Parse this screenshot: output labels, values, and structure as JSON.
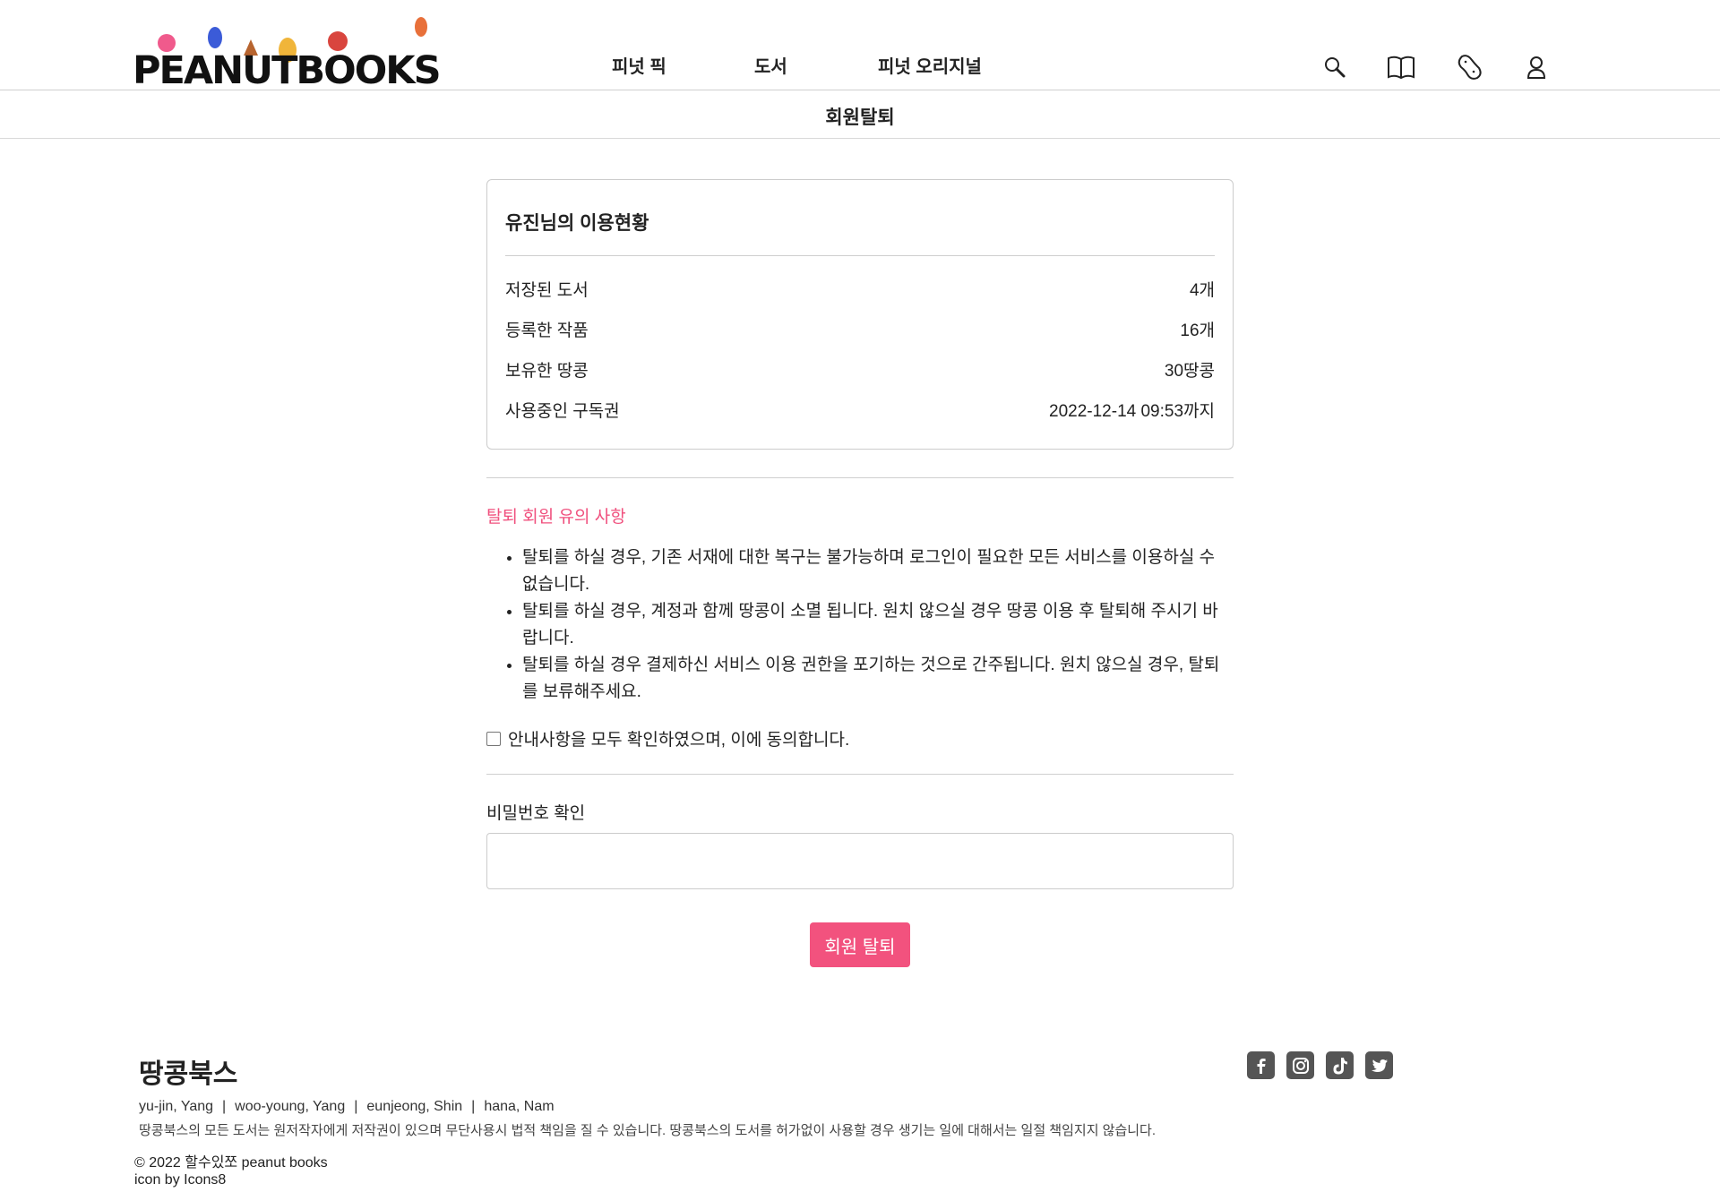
{
  "header": {
    "logo_text": "PEANUTBOOKS",
    "nav": [
      "피넛 픽",
      "도서",
      "피넛 오리지널"
    ],
    "icons": [
      "search-icon",
      "book-icon",
      "peanut-icon",
      "user-icon"
    ]
  },
  "page": {
    "title": "회원탈퇴"
  },
  "usage": {
    "title": "유진님의 이용현황",
    "rows": [
      {
        "label": "저장된 도서",
        "value": "4개"
      },
      {
        "label": "등록한 작품",
        "value": "16개"
      },
      {
        "label": "보유한 땅콩",
        "value": "30땅콩"
      },
      {
        "label": "사용중인 구독권",
        "value": "2022-12-14 09:53까지"
      }
    ]
  },
  "notice": {
    "title": "탈퇴 회원 유의 사항",
    "items": [
      "탈퇴를 하실 경우, 기존 서재에 대한 복구는 불가능하며 로그인이 필요한 모든 서비스를 이용하실 수 없습니다.",
      "탈퇴를 하실 경우, 계정과 함께 땅콩이 소멸 됩니다. 원치 않으실 경우 땅콩 이용 후 탈퇴해 주시기 바랍니다.",
      "탈퇴를 하실 경우 결제하신 서비스 이용 권한을 포기하는 것으로 간주됩니다. 원치 않으실 경우, 탈퇴를 보류해주세요."
    ],
    "agree_label": "안내사항을 모두 확인하였으며, 이에 동의합니다."
  },
  "password": {
    "label": "비밀번호 확인",
    "value": ""
  },
  "submit_label": "회원 탈퇴",
  "footer": {
    "brand": "땅콩북스",
    "team": [
      "yu-jin, Yang",
      "woo-young, Yang",
      "eunjeong, Shin",
      "hana, Nam"
    ],
    "notice": "땅콩북스의 모든 도서는 원저작자에게 저작권이 있으며 무단사용시 법적 책임을 질 수 있습니다. 땅콩북스의 도서를 허가없이 사용할 경우 생기는 일에 대해서는 일절 책임지지 않습니다.",
    "copyright": "© 2022 할수있쪼 peanut books",
    "credit": "icon by Icons8",
    "social": [
      "facebook-icon",
      "instagram-icon",
      "tiktok-icon",
      "twitter-icon"
    ]
  },
  "colors": {
    "accent": "#f2527e",
    "notice_title": "#f0507e",
    "border": "#cccccc"
  }
}
